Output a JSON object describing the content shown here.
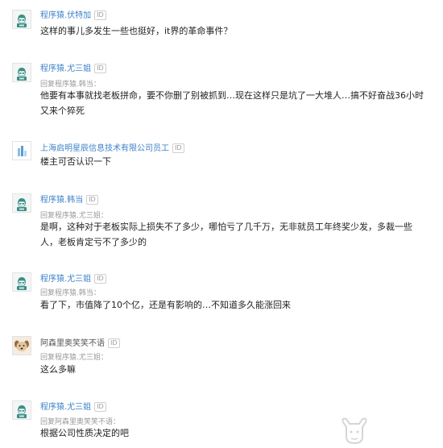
{
  "comments": [
    {
      "avatar": "programmer-avatar-icon",
      "name": "程序猿.伏特加",
      "id_label": "ID",
      "reply_to": "",
      "text": "这样的事儿多发生一些也挺好，it界的革命事件？"
    },
    {
      "avatar": "programmer-avatar-icon",
      "name": "程序猿.尤三姐",
      "id_label": "ID",
      "reply_to": "回复程序猿.韩当：",
      "text_line1": "他要有本事就找老板拼命，要不你删了别被抓到…现在这样只是坑了一大堆人…搞不好奋战36小时",
      "text_line2": "又来个猝死"
    },
    {
      "avatar": "company-avatar-icon",
      "name": "上海启明星辰信息技术有限公司员工",
      "id_label": "ID",
      "reply_to": "",
      "text": "楼主可否认识一下"
    },
    {
      "avatar": "programmer-avatar-icon",
      "name": "程序猿.韩当",
      "id_label": "ID",
      "reply_to": "回复程序猿.尤三姐：",
      "text_line1": "是啊，这种对于老板实际上损失不了多少，哪怕亏了几千万，无非就员工年终奖少发，多裁一些",
      "text_line2": "人，老板肯定亏不了多少的"
    },
    {
      "avatar": "programmer-avatar-icon",
      "name": "程序猿.尤三姐",
      "id_label": "ID",
      "reply_to": "回复程序猿.韩当：",
      "text": "看了下，市值降了10个亿，还是有影响的…不知道多久能涨回来"
    },
    {
      "avatar": "dog-avatar-icon",
      "name": "阿森里奥笑笑不语",
      "id_label": "ID",
      "reply_to": "回复程序猿.尤三姐：",
      "text": "这么多嘛"
    },
    {
      "avatar": "programmer-avatar-icon",
      "name": "程序猿.尤三姐",
      "id_label": "ID",
      "reply_to": "回复阿森里奥笑笑不语：",
      "text": "根据公司性质决定的吧"
    }
  ],
  "colors": {
    "name_link": "#3d82c9",
    "body_text": "#222222",
    "reply_text": "#999999",
    "background": "#ffffff"
  },
  "watermark_icon": "bull-logo-icon"
}
